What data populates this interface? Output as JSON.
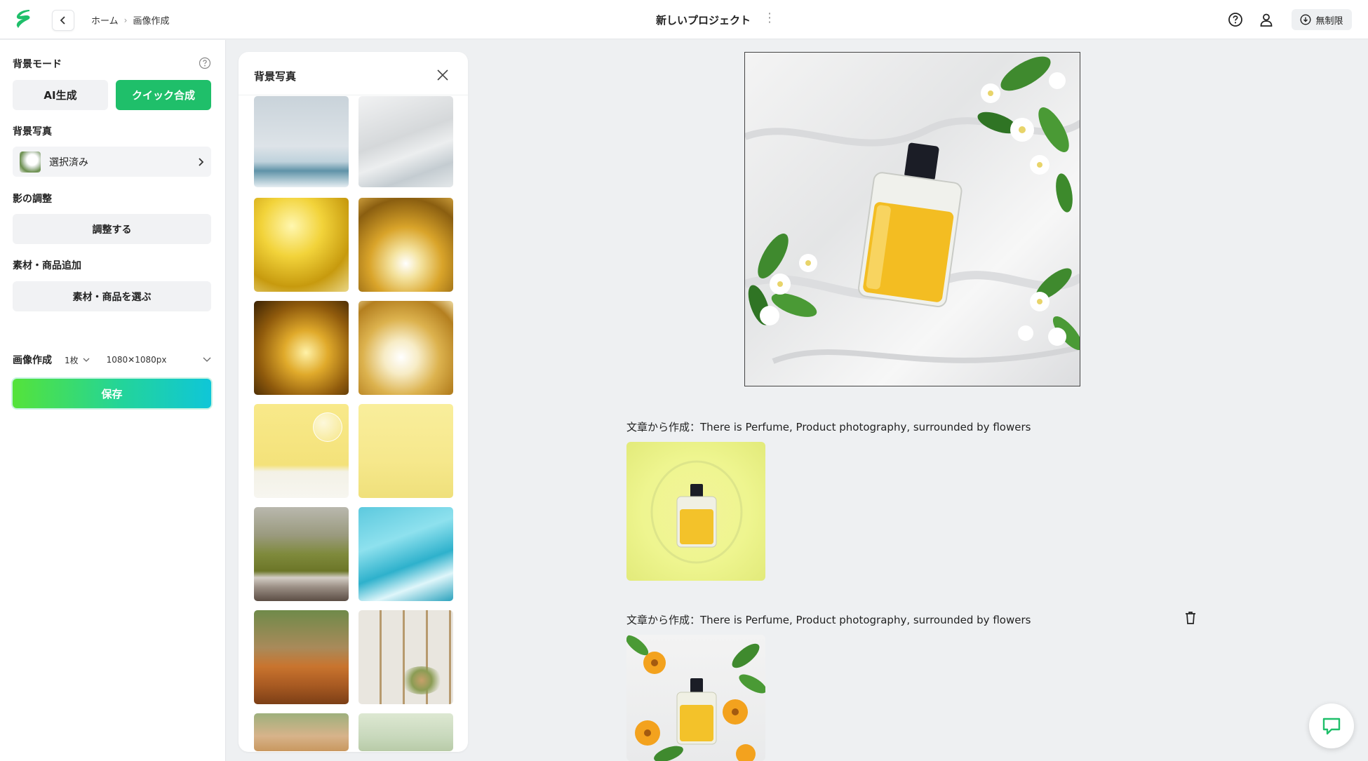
{
  "header": {
    "breadcrumb": [
      "ホーム",
      "画像作成"
    ],
    "project_title": "新しいプロジェクト",
    "plan_label": "無制限"
  },
  "sidebar": {
    "bg_mode_label": "背景モード",
    "mode_ai": "AI生成",
    "mode_quick": "クイック合成",
    "bg_photo_label": "背景写真",
    "bg_selected": "選択済み",
    "shadow_label": "影の調整",
    "shadow_button": "調整する",
    "material_label": "素材・商品追加",
    "material_button": "素材・商品を選ぶ",
    "generate_label": "画像作成",
    "count_value": "1枚",
    "size_value": "1080✕1080px",
    "save_button": "保存"
  },
  "picker": {
    "title": "背景写真",
    "tiles": [
      "concrete-blue-water-scene",
      "white-wall-water-scene",
      "golden-flowers-scene",
      "golden-daisies-scene",
      "golden-feather-scene",
      "golden-daisies-closeup-scene",
      "yellow-bubble-scene",
      "yellow-plain-scene",
      "rice-field-wood-scene",
      "turquoise-light-scene",
      "wood-table-garden-scene",
      "white-tile-window-scene",
      "plants-scene",
      "mint-tile-scene"
    ]
  },
  "results": [
    {
      "caption": "文章から作成：There is Perfume, Product photography, surrounded by flowers"
    },
    {
      "caption": "文章から作成：There is Perfume, Product photography, surrounded by flowers"
    }
  ],
  "colors": {
    "accent_green": "#1fbf6a",
    "save_gradient": [
      "#54e33a",
      "#0fc6d8"
    ],
    "background": "#eef0f2"
  },
  "icons": {
    "logo": "brand-logo-icon",
    "back": "chevron-left-icon",
    "help": "help-circle-icon",
    "account": "user-icon",
    "plan": "download-circle-icon",
    "close": "close-icon",
    "delete": "trash-icon",
    "chat": "chat-icon"
  }
}
